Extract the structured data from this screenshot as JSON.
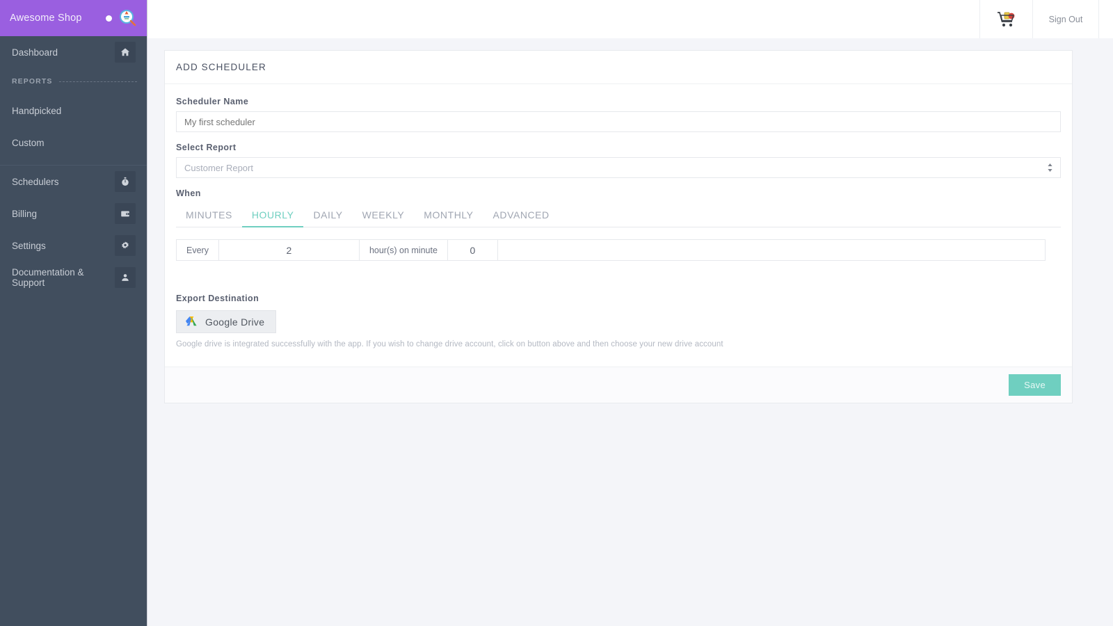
{
  "sidebar": {
    "brand": {
      "name": "Awesome Shop",
      "dot_icon": "status-dot",
      "logo_icon": "search-analytics-icon"
    },
    "dashboard": {
      "label": "Dashboard",
      "icon": "home-icon"
    },
    "reports_group": {
      "label": "REPORTS"
    },
    "report_items": [
      {
        "label": "Handpicked"
      },
      {
        "label": "Custom"
      }
    ],
    "nav_items": [
      {
        "label": "Schedulers",
        "icon": "stopwatch-icon"
      },
      {
        "label": "Billing",
        "icon": "wallet-icon"
      },
      {
        "label": "Settings",
        "icon": "gear-icon"
      },
      {
        "label": "Documentation & Support",
        "icon": "support-agent-icon"
      }
    ],
    "bg_color": "#414e5e",
    "brand_color": "#9a5fe0"
  },
  "topbar": {
    "cart_icon": "shopping-cart-icon",
    "signout_label": "Sign Out"
  },
  "card": {
    "title": "ADD SCHEDULER",
    "scheduler_name": {
      "label": "Scheduler Name",
      "value": "",
      "placeholder": "My first scheduler"
    },
    "select_report": {
      "label": "Select Report",
      "selected": "Customer Report",
      "options": [
        "Customer Report"
      ],
      "arrow_icon": "updown-chevron-icon"
    },
    "when": {
      "label": "When",
      "tabs": [
        {
          "label": "MINUTES",
          "active": false
        },
        {
          "label": "HOURLY",
          "active": true
        },
        {
          "label": "DAILY",
          "active": false
        },
        {
          "label": "WEEKLY",
          "active": false
        },
        {
          "label": "MONTHLY",
          "active": false
        },
        {
          "label": "ADVANCED",
          "active": false
        }
      ],
      "frequency": {
        "prefix_label": "Every",
        "hours_value": "2",
        "middle_label": "hour(s) on minute",
        "minute_value": "0"
      }
    },
    "export": {
      "label": "Export Destination",
      "button_label": "Google Drive",
      "button_icon": "google-drive-icon",
      "note": "Google drive is integrated successfully with the app. If you wish to change drive account, click on button above and then choose your new drive account"
    },
    "footer": {
      "save_label": "Save",
      "save_color": "#6fcfc0"
    }
  },
  "theme": {
    "accent_teal": "#6fcfc0",
    "page_bg": "#f4f5f9"
  }
}
